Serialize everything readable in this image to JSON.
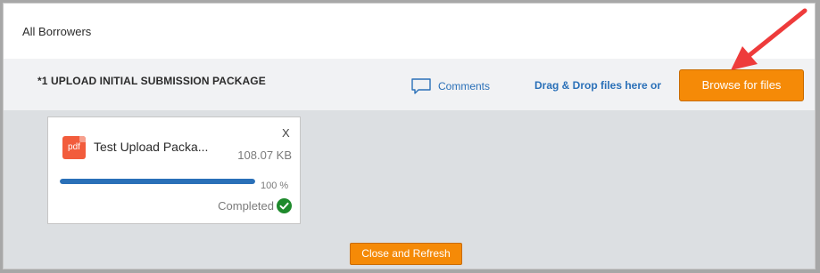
{
  "header": {
    "title": "All Borrowers"
  },
  "section": {
    "title": "*1 UPLOAD INITIAL SUBMISSION PACKAGE",
    "comments_label": "Comments",
    "drag_drop_text": "Drag & Drop files here or",
    "browse_label": "Browse for files"
  },
  "file": {
    "name": "Test Upload Packa...",
    "size": "108.07 KB",
    "progress": 100,
    "progress_label": "100 %",
    "status": "Completed",
    "close_label": "X",
    "type_label": "pdf"
  },
  "footer": {
    "refresh_label": "Close and Refresh"
  },
  "colors": {
    "accent_orange": "#f58a07",
    "link_blue": "#2a70b8",
    "success_green": "#1e8a2c",
    "annotation_red": "#ee3b3b"
  }
}
